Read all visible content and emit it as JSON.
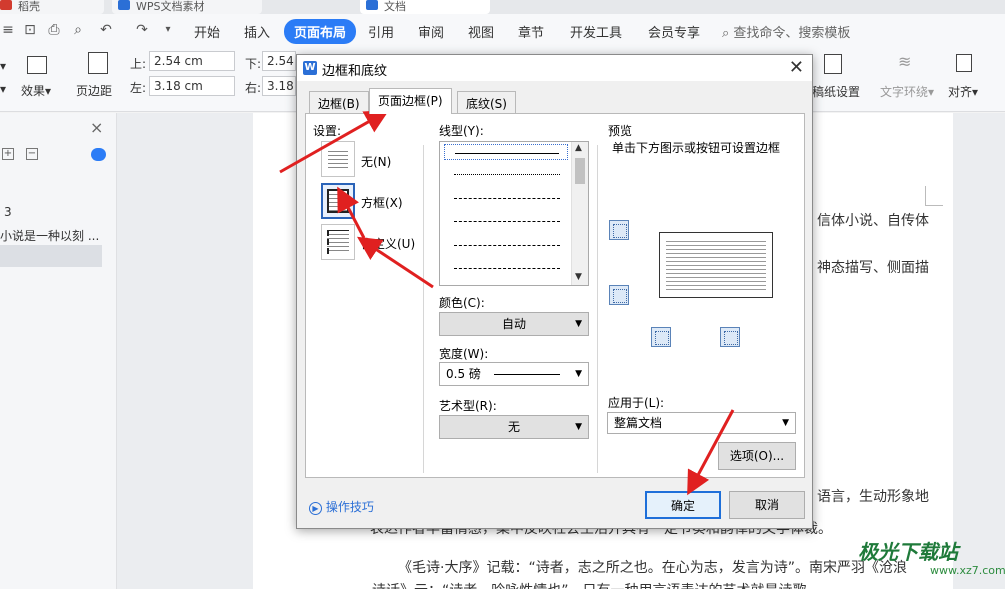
{
  "tabstrip": {
    "tabs": [
      "稻壳",
      "WPS文档素材",
      "文档"
    ]
  },
  "menubar": {
    "items": [
      "开始",
      "插入",
      "页面布局",
      "引用",
      "审阅",
      "视图",
      "章节",
      "开发工具",
      "会员专享"
    ],
    "active": "页面布局",
    "search": "查找命令、搜索模板"
  },
  "ribbon": {
    "effects_label": "效果",
    "margins_label": "页边距",
    "top_label": "上:",
    "top_value": "2.54 cm",
    "bottom_label": "下:",
    "bottom_value": "2.54",
    "left_label": "左:",
    "left_value": "3.18 cm",
    "right_label": "右:",
    "right_value": "3.18",
    "paper_setting_label": "稿纸设置",
    "text_wrap_label": "文字环绕",
    "align_label": "对齐"
  },
  "leftpane": {
    "item_num": "3",
    "item_text": "小说是一种以刻 ..."
  },
  "document": {
    "line1": "信体小说、自传体",
    "line2": "神态描写、侧面描",
    "line3": "语言，生动形象地",
    "line4": "表达作者丰富情感，集中反映社会生活并具有一定节奏和韵律的文学体裁。",
    "line5": "《毛诗·大序》记载：“诗者，志之所之也。在心为志，发言为诗”。南宋严羽《沧浪",
    "line6": "诗话》云：“诗者，吟咏性情也”。只有一种用言语表达的艺术就是诗歌"
  },
  "dialog": {
    "title": "边框和底纹",
    "tabs": [
      "边框(B)",
      "页面边框(P)",
      "底纹(S)"
    ],
    "active_tab": "页面边框(P)",
    "setting_label": "设置:",
    "settings": [
      "无(N)",
      "方框(X)",
      "自定义(U)"
    ],
    "selected_setting": "方框(X)",
    "linestyle_label": "线型(Y):",
    "color_label": "颜色(C):",
    "color_value": "自动",
    "width_label": "宽度(W):",
    "width_value": "0.5  磅",
    "art_label": "艺术型(R):",
    "art_value": "无",
    "preview_label": "预览",
    "preview_hint": "单击下方图示或按钮可设置边框",
    "apply_label": "应用于(L):",
    "apply_value": "整篇文档",
    "options_button": "选项(O)...",
    "tips_link": "操作技巧",
    "ok_button": "确定",
    "cancel_button": "取消"
  },
  "watermark": {
    "brand": "极光下载站",
    "url": "www.xz7.com"
  },
  "colors": {
    "accent": "#2b7cf6",
    "arrow": "#e02020"
  }
}
